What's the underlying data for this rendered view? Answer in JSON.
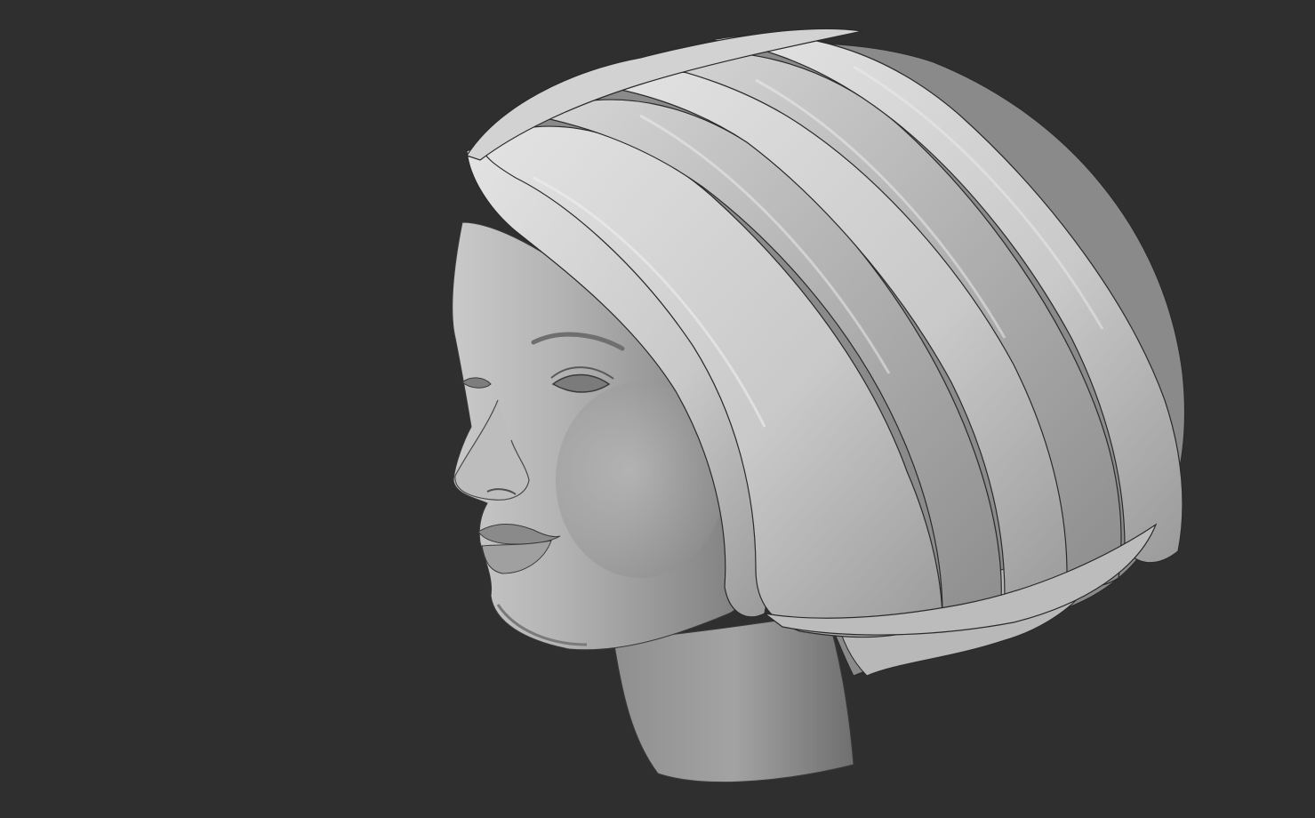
{
  "viewport": {
    "background": "#2f2f2f",
    "subject": "sculpt-head-with-bob-hair"
  },
  "colors": {
    "clay_light": "#e0e0e0",
    "clay_mid": "#a9a9a9",
    "clay_dark": "#6e6e6e",
    "edge": "#2a2a2a"
  }
}
